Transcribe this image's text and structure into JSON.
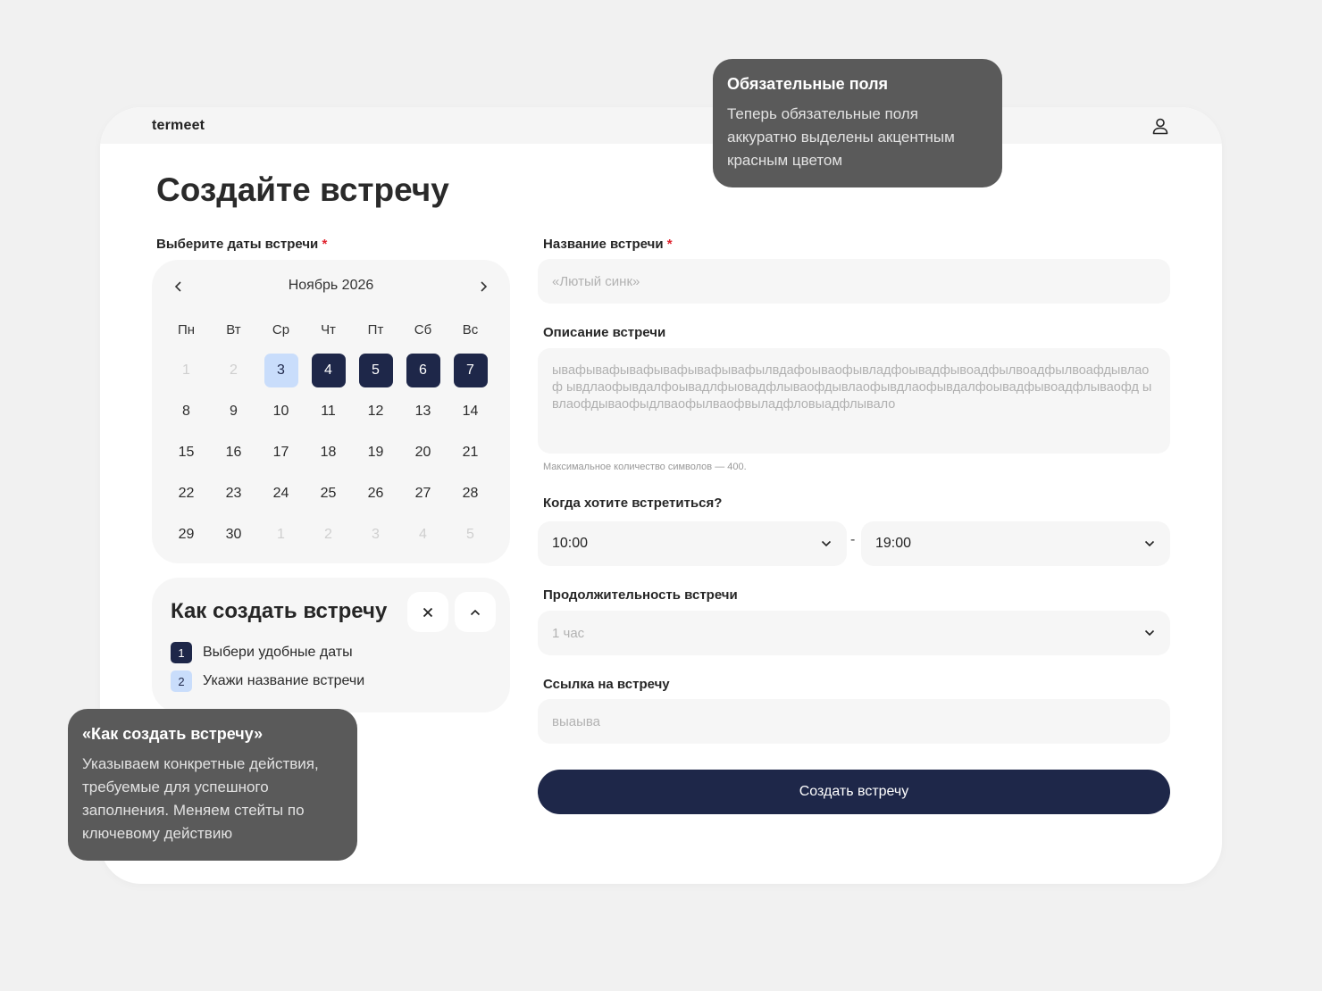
{
  "app": {
    "logo": "termeet"
  },
  "page": {
    "title": "Создайте встречу"
  },
  "calendar": {
    "label": "Выберите даты встречи",
    "required_mark": "*",
    "month": "Ноябрь 2026",
    "weekdays": [
      "Пн",
      "Вт",
      "Ср",
      "Чт",
      "Пт",
      "Сб",
      "Вс"
    ],
    "days": [
      {
        "d": "1",
        "s": "muted"
      },
      {
        "d": "2",
        "s": "muted"
      },
      {
        "d": "3",
        "s": "light"
      },
      {
        "d": "4",
        "s": "dark"
      },
      {
        "d": "5",
        "s": "dark"
      },
      {
        "d": "6",
        "s": "dark"
      },
      {
        "d": "7",
        "s": "dark"
      },
      {
        "d": "8",
        "s": ""
      },
      {
        "d": "9",
        "s": ""
      },
      {
        "d": "10",
        "s": ""
      },
      {
        "d": "11",
        "s": ""
      },
      {
        "d": "12",
        "s": ""
      },
      {
        "d": "13",
        "s": ""
      },
      {
        "d": "14",
        "s": ""
      },
      {
        "d": "15",
        "s": ""
      },
      {
        "d": "16",
        "s": ""
      },
      {
        "d": "17",
        "s": ""
      },
      {
        "d": "18",
        "s": ""
      },
      {
        "d": "19",
        "s": ""
      },
      {
        "d": "20",
        "s": ""
      },
      {
        "d": "21",
        "s": ""
      },
      {
        "d": "22",
        "s": ""
      },
      {
        "d": "23",
        "s": ""
      },
      {
        "d": "24",
        "s": ""
      },
      {
        "d": "25",
        "s": ""
      },
      {
        "d": "26",
        "s": ""
      },
      {
        "d": "27",
        "s": ""
      },
      {
        "d": "28",
        "s": ""
      },
      {
        "d": "29",
        "s": ""
      },
      {
        "d": "30",
        "s": ""
      },
      {
        "d": "1",
        "s": "muted"
      },
      {
        "d": "2",
        "s": "muted"
      },
      {
        "d": "3",
        "s": "muted"
      },
      {
        "d": "4",
        "s": "muted"
      },
      {
        "d": "5",
        "s": "muted"
      }
    ]
  },
  "howto": {
    "title": "Как создать встречу",
    "steps": [
      {
        "num": "1",
        "text": "Выбери удобные даты"
      },
      {
        "num": "2",
        "text": "Укажи название встречи"
      }
    ]
  },
  "form": {
    "name_label": "Название встречи",
    "required_mark": "*",
    "name_placeholder": "«Лютый синк»",
    "desc_label": "Описание встречи",
    "desc_value": "ывафывафывафывафывафывафылвдафоываофывладфоывадфывоадфылвоадфылвоафдывлаоф ывдлаофывдалфоывадлфыовадфлываофдывлаофывдлаофывдалфоывадфывоадфлываофд ывлаофдываофыдлваофылваофвыладфловыадфлывало",
    "desc_hint": "Максимальное количество символов — 400.",
    "when_label": "Когда хотите встретиться?",
    "time_from": "10:00",
    "time_dash": "-",
    "time_to": "19:00",
    "duration_label": "Продолжительность встречи",
    "duration_value": "1 час",
    "link_label": "Ссылка на встречу",
    "link_value": "выаыва",
    "submit_label": "Создать встречу"
  },
  "notes": {
    "required_title": "Обязательные поля",
    "required_text": "Теперь обязательные поля аккуратно выделены акцентным красным цветом",
    "howto_title": "«Как создать встречу»",
    "howto_text": "Указываем конкретные действия, требуемые для успешного заполнения. Меняем стейты по ключевому действию"
  },
  "colors": {
    "accent_dark": "#1e2749",
    "accent_light": "#c9ddfb",
    "required": "#e0242f",
    "note_bg": "#5a5a5a"
  },
  "icons": [
    "user-icon",
    "chevron-left-icon",
    "chevron-right-icon",
    "close-icon",
    "chevron-up-icon",
    "chevron-down-icon"
  ]
}
